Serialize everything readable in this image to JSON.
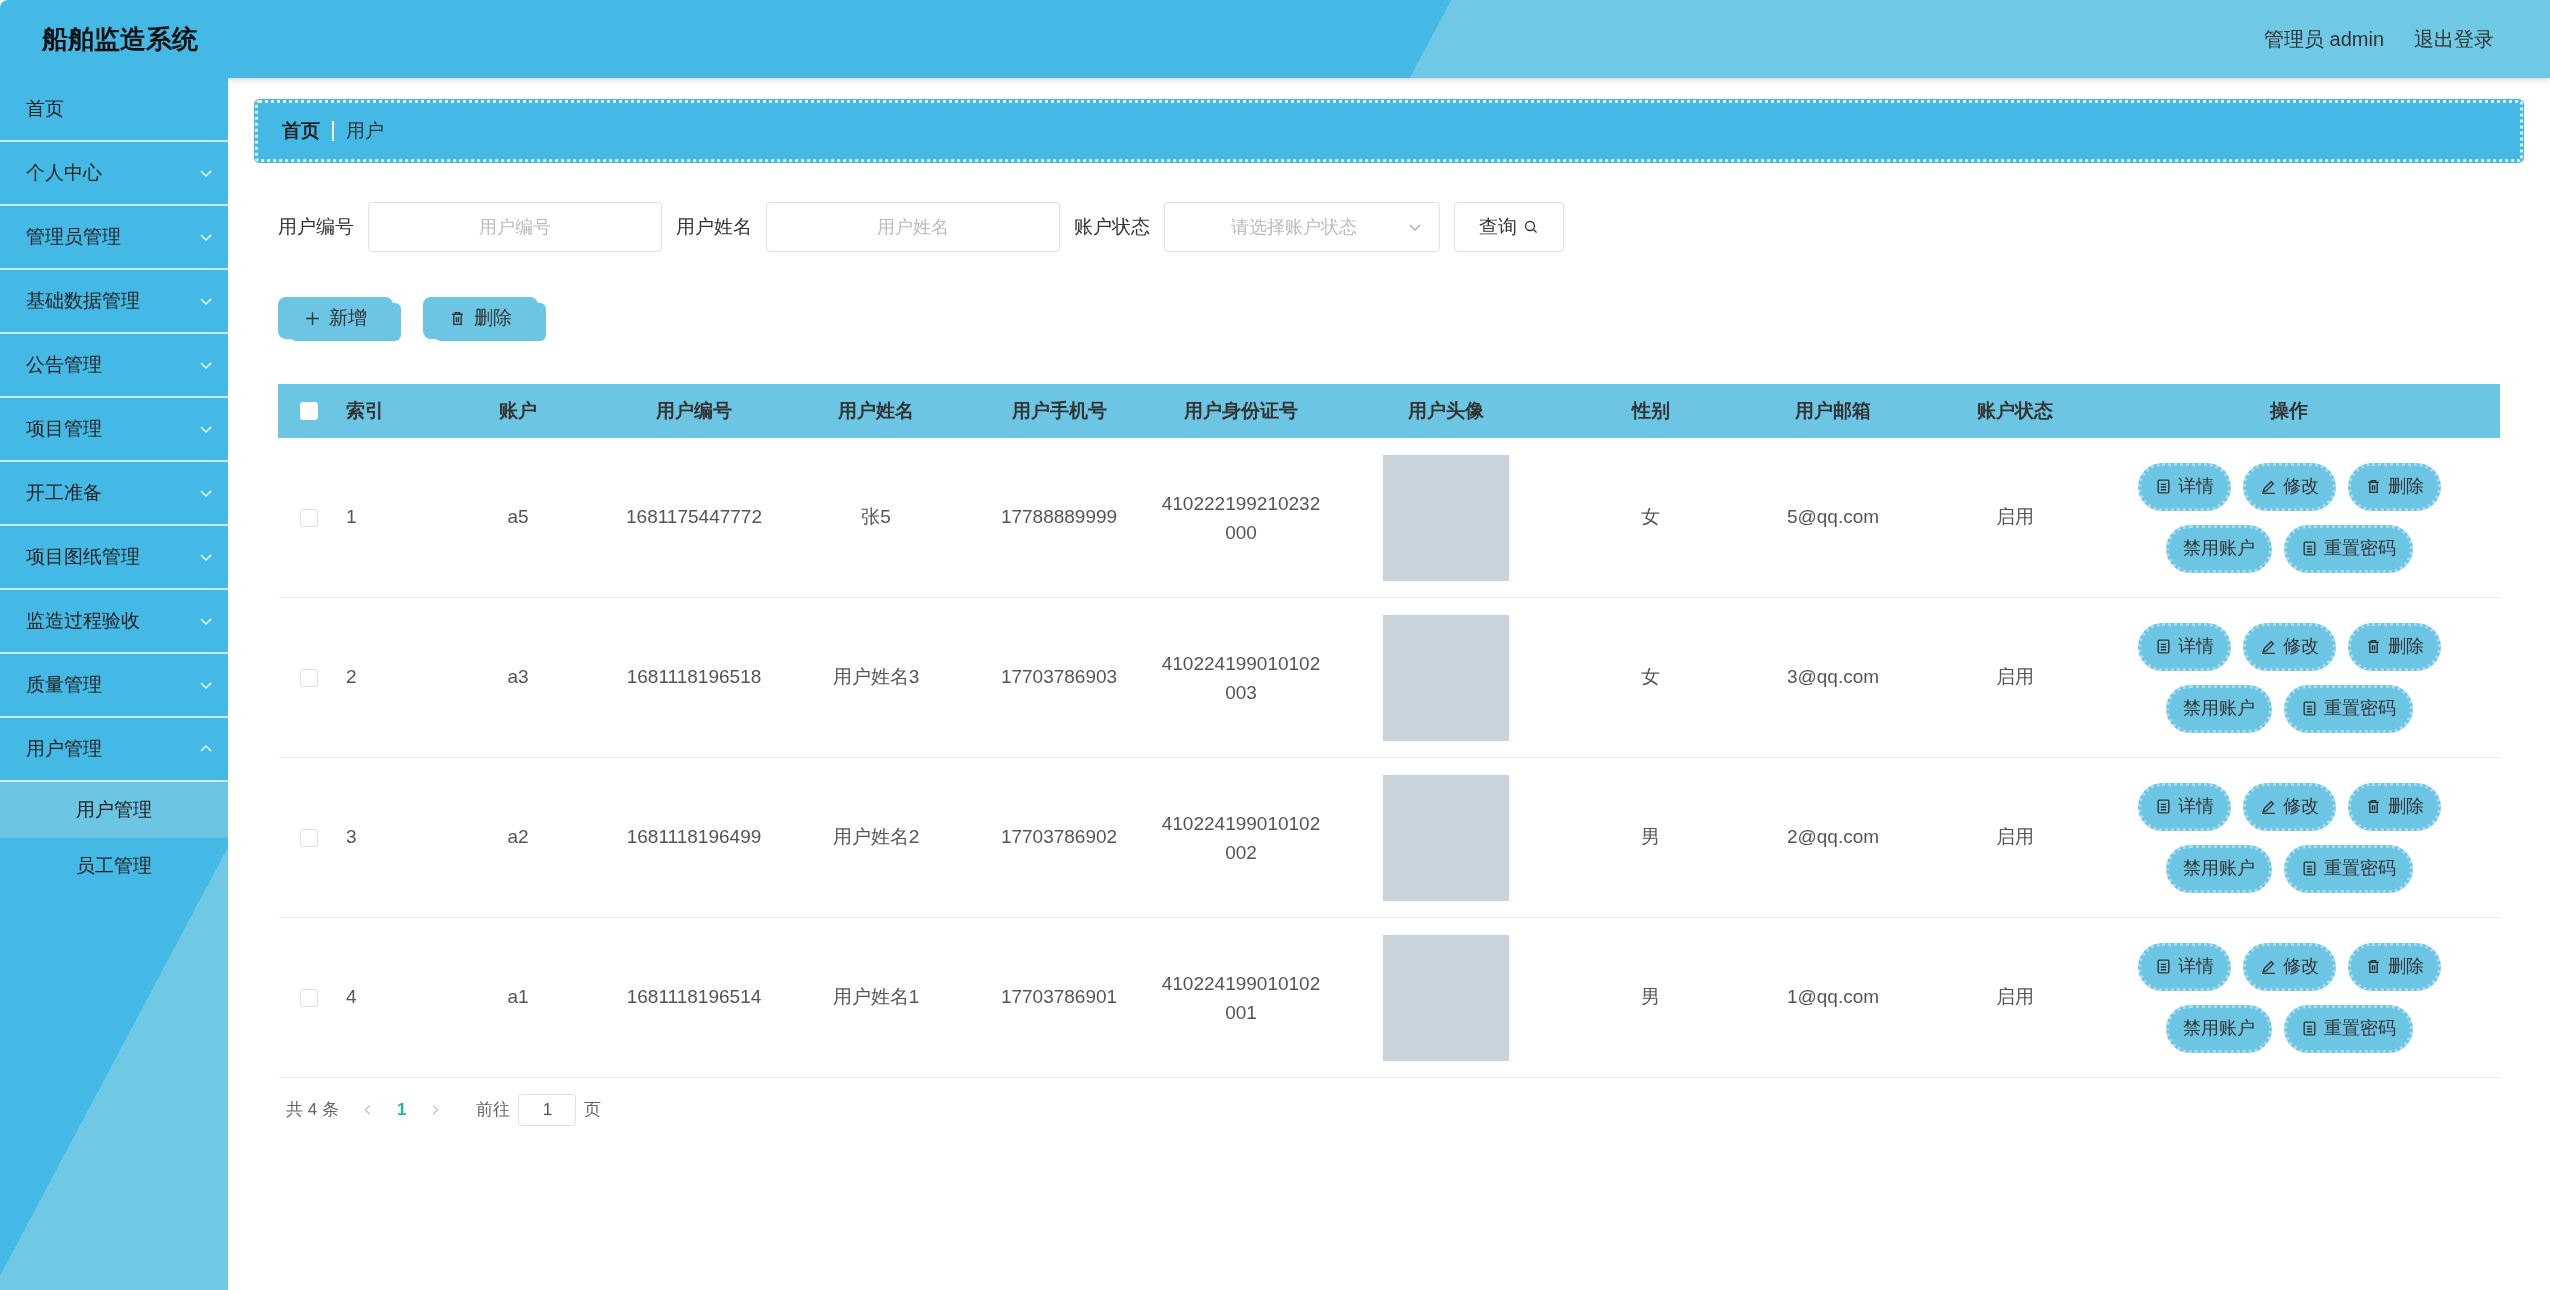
{
  "header": {
    "title": "船舶监造系统",
    "user": "管理员 admin",
    "logout": "退出登录"
  },
  "sidebar": {
    "items": [
      {
        "label": "首页",
        "kind": "link"
      },
      {
        "label": "个人中心",
        "kind": "menu",
        "expanded": false
      },
      {
        "label": "管理员管理",
        "kind": "menu",
        "expanded": false
      },
      {
        "label": "基础数据管理",
        "kind": "menu",
        "expanded": false
      },
      {
        "label": "公告管理",
        "kind": "menu",
        "expanded": false
      },
      {
        "label": "项目管理",
        "kind": "menu",
        "expanded": false
      },
      {
        "label": "开工准备",
        "kind": "menu",
        "expanded": false
      },
      {
        "label": "项目图纸管理",
        "kind": "menu",
        "expanded": false
      },
      {
        "label": "监造过程验收",
        "kind": "menu",
        "expanded": false
      },
      {
        "label": "质量管理",
        "kind": "menu",
        "expanded": false
      },
      {
        "label": "用户管理",
        "kind": "menu",
        "expanded": true,
        "children": [
          {
            "label": "用户管理",
            "selected": true
          },
          {
            "label": "员工管理",
            "selected": false
          }
        ]
      }
    ]
  },
  "breadcrumb": [
    "首页",
    "用户"
  ],
  "search": {
    "fields": [
      {
        "label": "用户编号",
        "kind": "input",
        "placeholder": "用户编号"
      },
      {
        "label": "用户姓名",
        "kind": "input",
        "placeholder": "用户姓名"
      },
      {
        "label": "账户状态",
        "kind": "select",
        "placeholder": "请选择账户状态"
      }
    ],
    "button": "查询"
  },
  "toolbar": [
    {
      "kind": "add",
      "label": "新增"
    },
    {
      "kind": "delete",
      "label": "删除"
    }
  ],
  "table": {
    "select_all": {
      "checked": false
    },
    "columns": [
      "索引",
      "账户",
      "用户编号",
      "用户姓名",
      "用户手机号",
      "用户身份证号",
      "用户头像",
      "性别",
      "用户邮箱",
      "账户状态",
      "操作"
    ],
    "rows": [
      {
        "checked": false,
        "cells": [
          "1",
          "a5",
          "1681175447772",
          "张5",
          "17788889999",
          "410222199210232000",
          "",
          "女",
          "5@qq.com",
          "启用"
        ],
        "actions": [
          {
            "kind": "detail",
            "label": "详情"
          },
          {
            "kind": "edit",
            "label": "修改"
          },
          {
            "kind": "delete",
            "label": "删除"
          },
          {
            "kind": "disable",
            "label": "禁用账户"
          },
          {
            "kind": "reset",
            "label": "重置密码"
          }
        ]
      },
      {
        "checked": false,
        "cells": [
          "2",
          "a3",
          "1681118196518",
          "用户姓名3",
          "17703786903",
          "410224199010102003",
          "",
          "女",
          "3@qq.com",
          "启用"
        ],
        "actions": [
          {
            "kind": "detail",
            "label": "详情"
          },
          {
            "kind": "edit",
            "label": "修改"
          },
          {
            "kind": "delete",
            "label": "删除"
          },
          {
            "kind": "disable",
            "label": "禁用账户"
          },
          {
            "kind": "reset",
            "label": "重置密码"
          }
        ]
      },
      {
        "checked": false,
        "cells": [
          "3",
          "a2",
          "1681118196499",
          "用户姓名2",
          "17703786902",
          "410224199010102002",
          "",
          "男",
          "2@qq.com",
          "启用"
        ],
        "actions": [
          {
            "kind": "detail",
            "label": "详情"
          },
          {
            "kind": "edit",
            "label": "修改"
          },
          {
            "kind": "delete",
            "label": "删除"
          },
          {
            "kind": "disable",
            "label": "禁用账户"
          },
          {
            "kind": "reset",
            "label": "重置密码"
          }
        ]
      },
      {
        "checked": false,
        "cells": [
          "4",
          "a1",
          "1681118196514",
          "用户姓名1",
          "17703786901",
          "410224199010102001",
          "",
          "男",
          "1@qq.com",
          "启用"
        ],
        "actions": [
          {
            "kind": "detail",
            "label": "详情"
          },
          {
            "kind": "edit",
            "label": "修改"
          },
          {
            "kind": "delete",
            "label": "删除"
          },
          {
            "kind": "disable",
            "label": "禁用账户"
          },
          {
            "kind": "reset",
            "label": "重置密码"
          }
        ]
      }
    ]
  },
  "pagination": {
    "total": "共 4 条",
    "pages": [
      {
        "label": "1",
        "selected": true
      }
    ],
    "goto_label": "前往",
    "goto_value": "1",
    "page_suffix": "页"
  }
}
